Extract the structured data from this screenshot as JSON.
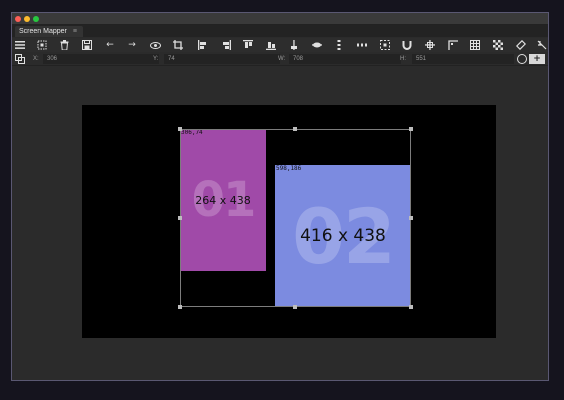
{
  "window": {
    "tab_title": "Screen Mapper",
    "tab_menu_glyph": "≡"
  },
  "toolbar": {
    "tools": [
      {
        "name": "menu-icon"
      },
      {
        "name": "select-icon"
      },
      {
        "name": "trash-icon"
      },
      {
        "name": "save-icon"
      },
      {
        "name": "arrow-left-icon",
        "glyph": "←"
      },
      {
        "name": "arrow-right-icon",
        "glyph": "→"
      },
      {
        "name": "eye-icon"
      },
      {
        "name": "crop-icon"
      },
      {
        "name": "align-left-icon"
      },
      {
        "name": "align-right-icon"
      },
      {
        "name": "align-top-icon"
      },
      {
        "name": "align-bottom-icon"
      },
      {
        "name": "align-center-vertical-icon"
      },
      {
        "name": "align-center-horizontal-icon"
      },
      {
        "name": "distribute-vertical-icon"
      },
      {
        "name": "distribute-horizontal-icon"
      },
      {
        "name": "fit-icon"
      },
      {
        "name": "magnet-icon"
      },
      {
        "name": "crosshair-icon"
      },
      {
        "name": "corner-icon"
      },
      {
        "name": "grid-icon"
      },
      {
        "name": "checkerboard-icon"
      },
      {
        "name": "eraser-icon"
      },
      {
        "name": "ruler-icon"
      }
    ]
  },
  "properties": {
    "x_label": "X:",
    "x_value": "306",
    "y_label": "Y:",
    "y_value": "74",
    "w_label": "W:",
    "w_value": "708",
    "h_label": "H:",
    "h_value": "551",
    "add_label": "+"
  },
  "screens": [
    {
      "id": "01",
      "coord": "306,74",
      "dims": "264 x 438",
      "color": "#a04aa8"
    },
    {
      "id": "02",
      "coord": "598,186",
      "dims": "416 x 438",
      "color": "#7c8be0"
    }
  ],
  "colors": {
    "background": "#15141e",
    "window": "#2b2b2b",
    "canvas": "#000000"
  }
}
